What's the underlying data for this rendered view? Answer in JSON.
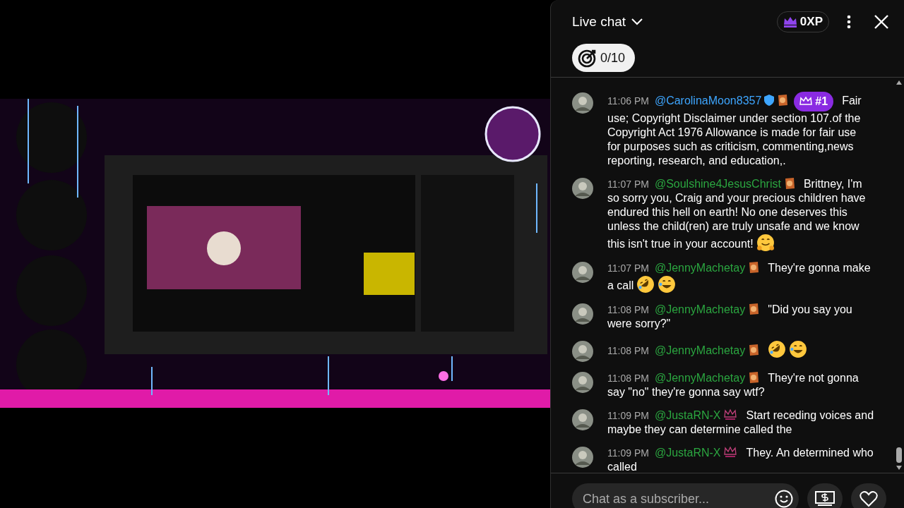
{
  "chat": {
    "title": "Live chat",
    "xp": "0XP",
    "goal": "0/10",
    "messages": [
      {
        "time": "11:06 PM",
        "author": "@CarolinaMoon8357",
        "color": "#3ea6ff",
        "badges": [
          {
            "kind": "verified"
          },
          {
            "kind": "sticker"
          },
          {
            "kind": "rank",
            "text": "#1"
          }
        ],
        "lines": [
          "Fair",
          "use; Copyright Disclaimer under section 107.of the",
          "Copyright Act 1976 Allowance is made for fair use",
          "for purposes such as criticism, commenting,news",
          "reporting, research, and education,."
        ]
      },
      {
        "time": "11:07 PM",
        "author": "@Soulshine4JesusChrist",
        "color": "#2ba640",
        "badges": [
          {
            "kind": "sticker"
          }
        ],
        "lines": [
          "Brittney, I'm",
          "so sorry you, Craig and your precious children have",
          "endured this hell on earth! No one deserves this",
          "unless the child(ren) are truly unsafe and we know",
          "this isn't true in your account!"
        ],
        "emojis": [
          {
            "kind": "hug"
          }
        ]
      },
      {
        "time": "11:07 PM",
        "author": "@JennyMachetay",
        "color": "#2ba640",
        "badges": [
          {
            "kind": "sticker"
          }
        ],
        "lines": [
          "They're gonna make",
          "a call"
        ],
        "emojis": [
          {
            "kind": "rofl"
          },
          {
            "kind": "joy"
          }
        ]
      },
      {
        "time": "11:08 PM",
        "author": "@JennyMachetay",
        "color": "#2ba640",
        "badges": [
          {
            "kind": "sticker"
          }
        ],
        "lines": [
          "\"Did you say you",
          "were sorry?\""
        ]
      },
      {
        "time": "11:08 PM",
        "author": "@JennyMachetay",
        "color": "#2ba640",
        "badges": [
          {
            "kind": "sticker"
          }
        ],
        "emojis": [
          {
            "kind": "rofl"
          },
          {
            "kind": "joy"
          }
        ]
      },
      {
        "time": "11:08 PM",
        "author": "@JennyMachetay",
        "color": "#2ba640",
        "badges": [
          {
            "kind": "sticker"
          }
        ],
        "lines": [
          "They're not gonna",
          "say \"no\" they're gonna say wtf?"
        ]
      },
      {
        "time": "11:09 PM",
        "author": "@JustaRN-X",
        "color": "#2ba640",
        "badges": [
          {
            "kind": "crown"
          }
        ],
        "lines": [
          "Start receding voices and",
          "maybe they can determine called the"
        ]
      },
      {
        "time": "11:09 PM",
        "author": "@JustaRN-X",
        "color": "#2ba640",
        "badges": [
          {
            "kind": "crown"
          }
        ],
        "lines": [
          "They. An determined who",
          "called"
        ]
      }
    ],
    "input": {
      "placeholder": "Chat as a subscriber..."
    }
  }
}
